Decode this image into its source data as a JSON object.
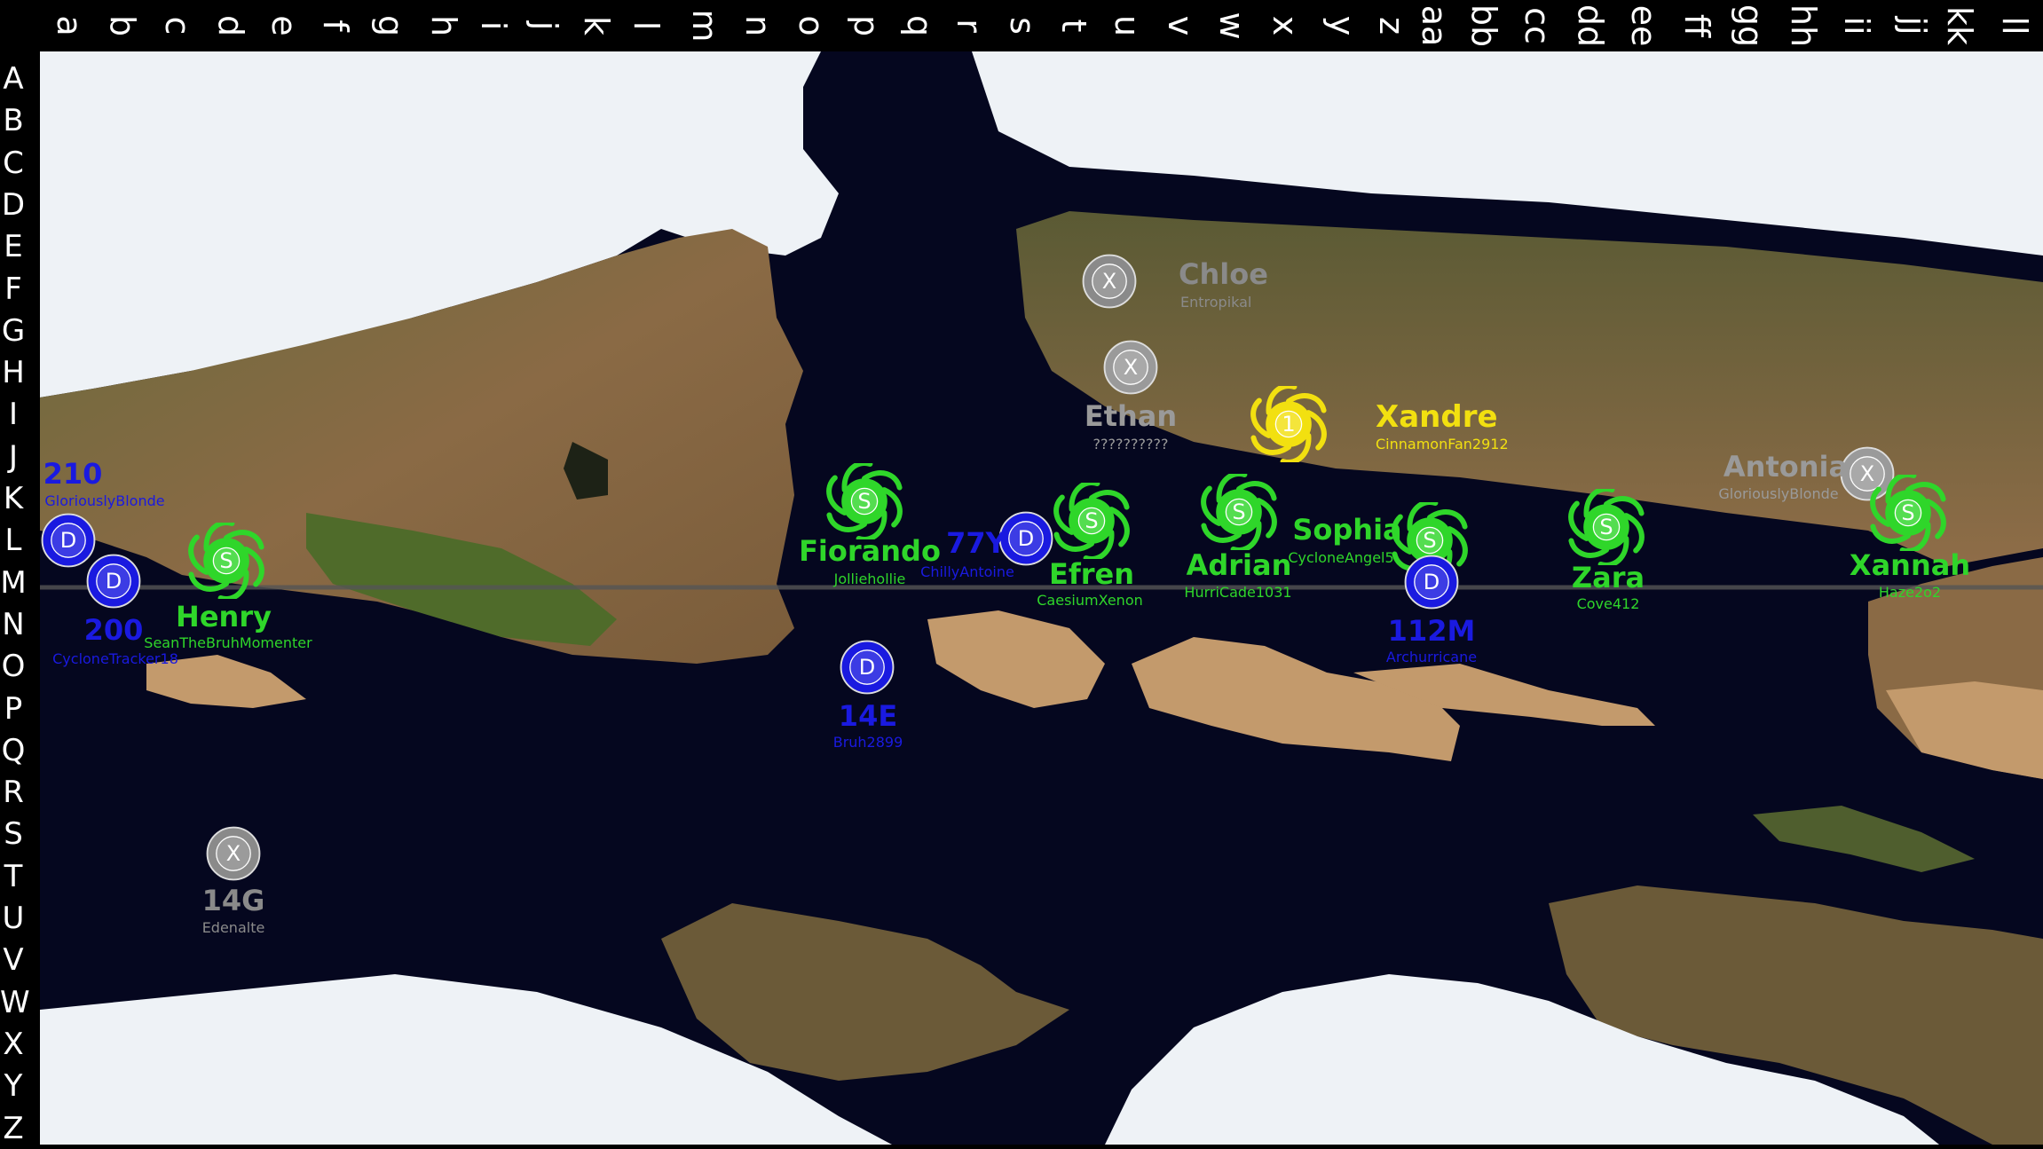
{
  "columns": [
    "a",
    "b",
    "c",
    "d",
    "e",
    "f",
    "g",
    "h",
    "i",
    "j",
    "k",
    "l",
    "m",
    "n",
    "o",
    "p",
    "q",
    "r",
    "s",
    "t",
    "u",
    "v",
    "w",
    "x",
    "y",
    "z",
    "aa",
    "bb",
    "cc",
    "dd",
    "ee",
    "ff",
    "gg",
    "hh",
    "ii",
    "jj",
    "kk",
    "ll"
  ],
  "rows": [
    "A",
    "B",
    "C",
    "D",
    "E",
    "F",
    "G",
    "H",
    "I",
    "J",
    "K",
    "L",
    "M",
    "N",
    "O",
    "P",
    "Q",
    "R",
    "S",
    "T",
    "U",
    "V",
    "W",
    "X",
    "Y",
    "Z"
  ],
  "colors": {
    "ocean": "#05071f",
    "ice": "#eef2f6",
    "land_brown": "#8a6a45",
    "land_green": "#4f5e2e",
    "land_tan": "#c39a6c",
    "storm_green": "#2fd62a",
    "storm_yellow": "#f2e010",
    "depression_blue": "#1616d8",
    "dissipated_gray": "#8a8a8a"
  },
  "storms": [
    {
      "id": "chloe",
      "type": "X",
      "name": "Chloe",
      "user": "Entropikal",
      "color": "#8a8a8a"
    },
    {
      "id": "ethan",
      "type": "X",
      "name": "Ethan",
      "user": "??????????",
      "color": "#9a9a9a"
    },
    {
      "id": "xandre",
      "type": "1",
      "name": "Xandre",
      "user": "CinnamonFan2912",
      "color": "#f2e010"
    },
    {
      "id": "antonia",
      "type": "X",
      "name": "Antonia",
      "user": "GloriouslyBlonde",
      "color": "#9a9a9a"
    },
    {
      "id": "210",
      "type": "D",
      "name": "210",
      "user": "GloriouslyBlonde",
      "color": "#1a1ae0"
    },
    {
      "id": "200",
      "type": "D",
      "name": "200",
      "user": "CycloneTracker18",
      "color": "#1a1ae0"
    },
    {
      "id": "henry",
      "type": "S",
      "name": "Henry",
      "user": "SeanTheBruhMomenter",
      "color": "#2fd62a"
    },
    {
      "id": "fiorando",
      "type": "S",
      "name": "Fiorando",
      "user": "Jolliehollie",
      "color": "#2fd62a"
    },
    {
      "id": "77y",
      "type": "D",
      "name": "77Y",
      "user": "ChillyAntoine",
      "color": "#1a1ae0"
    },
    {
      "id": "efren",
      "type": "S",
      "name": "Efren",
      "user": "CaesiumXenon",
      "color": "#2fd62a"
    },
    {
      "id": "adrian",
      "type": "S",
      "name": "Adrian",
      "user": "HurriCade1031",
      "color": "#2fd62a"
    },
    {
      "id": "sophia",
      "type": "S",
      "name": "Sophia",
      "user": "CycloneAngel5",
      "color": "#2fd62a"
    },
    {
      "id": "112m",
      "type": "D",
      "name": "112M",
      "user": "Archurricane",
      "color": "#1a1ae0"
    },
    {
      "id": "zara",
      "type": "S",
      "name": "Zara",
      "user": "Cove412",
      "color": "#2fd62a"
    },
    {
      "id": "xannah",
      "type": "S",
      "name": "Xannah",
      "user": "Haze2o2",
      "color": "#2fd62a"
    },
    {
      "id": "14e",
      "type": "D",
      "name": "14E",
      "user": "Bruh2899",
      "color": "#1a1ae0"
    },
    {
      "id": "14g",
      "type": "X",
      "name": "14G",
      "user": "Edenalte",
      "color": "#8a8a8a"
    }
  ]
}
